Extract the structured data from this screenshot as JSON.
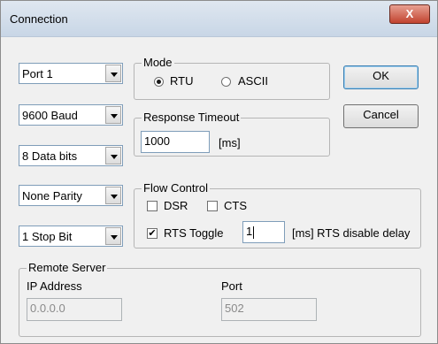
{
  "window": {
    "title": "Connection",
    "close_label": "X"
  },
  "serial": {
    "port": "Port 1",
    "baud": "9600 Baud",
    "data_bits": "8 Data bits",
    "parity": "None Parity",
    "stop_bits": "1 Stop Bit"
  },
  "mode": {
    "legend": "Mode",
    "rtu_label": "RTU",
    "ascii_label": "ASCII",
    "selected": "RTU"
  },
  "response_timeout": {
    "legend": "Response Timeout",
    "value": "1000",
    "unit": "[ms]"
  },
  "flow_control": {
    "legend": "Flow Control",
    "dsr_label": "DSR",
    "dsr_checked": false,
    "cts_label": "CTS",
    "cts_checked": false,
    "rts_toggle_label": "RTS Toggle",
    "rts_toggle_checked": true,
    "rts_delay_value": "1",
    "rts_delay_unit": "[ms] RTS disable delay"
  },
  "buttons": {
    "ok_label": "OK",
    "cancel_label": "Cancel"
  },
  "remote_server": {
    "legend": "Remote Server",
    "ip_label": "IP Address",
    "ip_value": "0.0.0.0",
    "port_label": "Port",
    "port_value": "502"
  }
}
